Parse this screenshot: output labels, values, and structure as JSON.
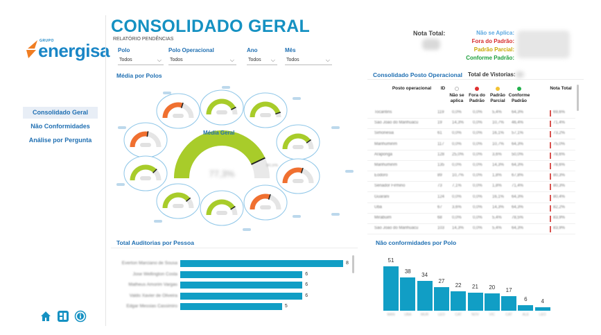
{
  "logo": {
    "grupo": "GRUPO",
    "name": "energisa"
  },
  "nav": [
    "Consolidado Geral",
    "Não Conformidades",
    "Análise por Pergunta"
  ],
  "header": {
    "title": "CONSOLIDADO GERAL",
    "subtitle": "RELATÓRIO PENDÊNCIAS"
  },
  "filters": [
    {
      "label": "Polo",
      "value": "Todos"
    },
    {
      "label": "Polo Operacional",
      "value": "Todos"
    },
    {
      "label": "Ano",
      "value": "Todos"
    },
    {
      "label": "Mês",
      "value": "Todos"
    }
  ],
  "nota_total": {
    "label": "Nota Total:"
  },
  "legend": [
    {
      "label": "Não se Aplica:",
      "color": "#5aa7e0"
    },
    {
      "label": "Fora do Padrão:",
      "color": "#d62b2b"
    },
    {
      "label": "Padrão Parcial:",
      "color": "#c9a800"
    },
    {
      "label": "Conforme Padrão:",
      "color": "#1a9e3a"
    }
  ],
  "media_polos": {
    "title": "Média por Polos",
    "center_label": "Média Geral",
    "center_value": "77,3%",
    "center_side": "90,5%"
  },
  "consolidado": {
    "title": "Consolidado Posto Operacional",
    "vistorias_label": "Total de Vistorias:",
    "columns": [
      "Posto operacional",
      "ID",
      "Não se aplica",
      "Fora do Padrão",
      "Padrão Parcial",
      "Conforme Padrão",
      "Nota Total"
    ],
    "rows": [
      [
        "Tocantins",
        "119",
        "0,0%",
        "0,0%",
        "5,4%",
        "64,3%",
        "69,6%"
      ],
      [
        "Sao Joao do Manhuacu",
        "19",
        "14,3%",
        "0,0%",
        "10,7%",
        "46,4%",
        "71,4%"
      ],
      [
        "Simonesia",
        "61",
        "0,0%",
        "0,0%",
        "16,1%",
        "57,1%",
        "73,2%"
      ],
      [
        "Manhumirim",
        "117",
        "0,0%",
        "0,0%",
        "10,7%",
        "64,3%",
        "75,0%"
      ],
      [
        "Araponga",
        "128",
        "25,0%",
        "0,0%",
        "3,6%",
        "50,0%",
        "78,6%"
      ],
      [
        "Manhumirim",
        "135",
        "0,0%",
        "0,0%",
        "14,3%",
        "64,3%",
        "78,6%"
      ],
      [
        "Eodoro",
        "89",
        "10,7%",
        "0,0%",
        "1,8%",
        "67,8%",
        "80,3%"
      ],
      [
        "Senador Firmino",
        "73",
        "7,1%",
        "0,0%",
        "1,8%",
        "71,4%",
        "80,3%"
      ],
      [
        "Guarani",
        "124",
        "0,0%",
        "0,0%",
        "16,1%",
        "64,3%",
        "80,4%"
      ],
      [
        "Ubá",
        "67",
        "3,6%",
        "0,0%",
        "14,3%",
        "64,3%",
        "82,2%"
      ],
      [
        "Mirabuim",
        "68",
        "0,0%",
        "0,0%",
        "5,4%",
        "78,5%",
        "83,9%"
      ],
      [
        "Sao Joao do Manhuacu",
        "103",
        "14,3%",
        "0,0%",
        "5,4%",
        "64,3%",
        "83,9%"
      ]
    ]
  },
  "auditorias": {
    "title": "Total Auditorias por Pessoa",
    "names": [
      "Everton Marciano de Sousa",
      "Jose Wellington Costa",
      "Matheus Amorim Vargas",
      "Valdo Xavier de Oliveira",
      "Edgar Messias Cassimiro"
    ],
    "values": [
      8,
      6,
      6,
      6,
      5
    ]
  },
  "nao_conformidades": {
    "title": "Não conformidades por Polo",
    "categories": [
      "MAN",
      "UBA",
      "MUR",
      "LEO",
      "CAT",
      "NOV",
      "VIC",
      "CAT",
      "ALE",
      "LEO"
    ],
    "values": [
      51,
      38,
      34,
      27,
      22,
      21,
      20,
      17,
      6,
      4
    ]
  },
  "chart_data": [
    {
      "type": "bar",
      "title": "Total Auditorias por Pessoa",
      "categories": [
        "Everton Marciano de Sousa",
        "Jose Wellington Costa",
        "Matheus Amorim Vargas",
        "Valdo Xavier de Oliveira",
        "Edgar Messias Cassimiro"
      ],
      "values": [
        8,
        6,
        6,
        6,
        5
      ]
    },
    {
      "type": "bar",
      "title": "Não conformidades por Polo",
      "categories": [
        "MAN",
        "UBA",
        "MUR",
        "LEO",
        "CAT",
        "NOV",
        "VIC",
        "CAT",
        "ALE",
        "LEO"
      ],
      "values": [
        51,
        38,
        34,
        27,
        22,
        21,
        20,
        17,
        6,
        4
      ]
    }
  ]
}
